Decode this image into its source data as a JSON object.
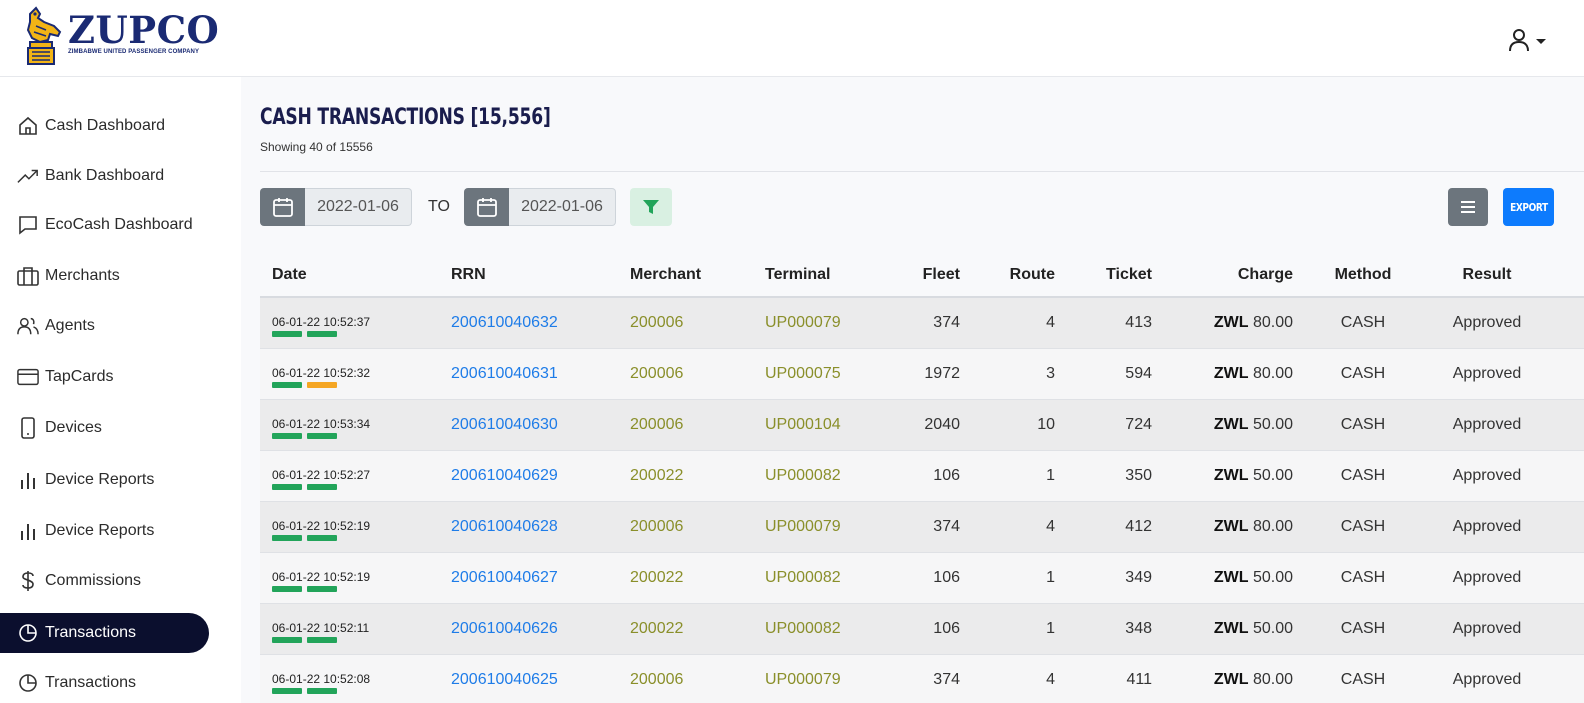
{
  "brand": {
    "name": "ZUPCO",
    "subtitle": "ZIMBABWE UNITED PASSENGER COMPANY",
    "logo_icon": "zimbabwe-bird-icon"
  },
  "header": {
    "user_icon": "user-icon"
  },
  "sidebar": {
    "items": [
      {
        "label": "Cash Dashboard",
        "icon": "home-icon"
      },
      {
        "label": "Bank Dashboard",
        "icon": "trend-up-icon"
      },
      {
        "label": "EcoCash Dashboard",
        "icon": "chat-icon"
      },
      {
        "label": "Merchants",
        "icon": "briefcase-icon"
      },
      {
        "label": "Agents",
        "icon": "people-icon"
      },
      {
        "label": "TapCards",
        "icon": "card-icon"
      },
      {
        "label": "Devices",
        "icon": "phone-icon"
      },
      {
        "label": "Device Reports",
        "icon": "bar-chart-icon"
      },
      {
        "label": "Device Reports",
        "icon": "bar-chart-icon"
      },
      {
        "label": "Commissions",
        "icon": "dollar-icon"
      },
      {
        "label": "Transactions",
        "icon": "pie-chart-icon",
        "active": true
      },
      {
        "label": "Transactions",
        "icon": "pie-chart-icon"
      }
    ]
  },
  "main": {
    "title": "CASH TRANSACTIONS [15,556]",
    "subtitle": "Showing 40 of 15556",
    "date_from": "2022-01-06",
    "to_label": "TO",
    "date_to": "2022-01-06",
    "export_label": "EXPORT"
  },
  "colors": {
    "accent": "#0d7bfd",
    "active_nav": "#0b0f2e",
    "status_green": "#22a45a",
    "status_orange": "#f5a623",
    "link": "#1e7ce8",
    "olive": "#8a8f2a"
  },
  "table": {
    "headers": [
      "Date",
      "RRN",
      "Merchant",
      "Terminal",
      "Fleet",
      "Route",
      "Ticket",
      "Charge",
      "Method",
      "Result"
    ],
    "rows": [
      {
        "date": "06-01-22 10:52:37",
        "bars": [
          "green",
          "green"
        ],
        "rrn": "200610040632",
        "merchant": "200006",
        "terminal": "UP000079",
        "fleet": "374",
        "route": "4",
        "ticket": "413",
        "currency": "ZWL",
        "amount": "80.00",
        "method": "CASH",
        "result": "Approved"
      },
      {
        "date": "06-01-22 10:52:32",
        "bars": [
          "green",
          "orange"
        ],
        "rrn": "200610040631",
        "merchant": "200006",
        "terminal": "UP000075",
        "fleet": "1972",
        "route": "3",
        "ticket": "594",
        "currency": "ZWL",
        "amount": "80.00",
        "method": "CASH",
        "result": "Approved"
      },
      {
        "date": "06-01-22 10:53:34",
        "bars": [
          "green",
          "green"
        ],
        "rrn": "200610040630",
        "merchant": "200006",
        "terminal": "UP000104",
        "fleet": "2040",
        "route": "10",
        "ticket": "724",
        "currency": "ZWL",
        "amount": "50.00",
        "method": "CASH",
        "result": "Approved"
      },
      {
        "date": "06-01-22 10:52:27",
        "bars": [
          "green",
          "green"
        ],
        "rrn": "200610040629",
        "merchant": "200022",
        "terminal": "UP000082",
        "fleet": "106",
        "route": "1",
        "ticket": "350",
        "currency": "ZWL",
        "amount": "50.00",
        "method": "CASH",
        "result": "Approved"
      },
      {
        "date": "06-01-22 10:52:19",
        "bars": [
          "green",
          "green"
        ],
        "rrn": "200610040628",
        "merchant": "200006",
        "terminal": "UP000079",
        "fleet": "374",
        "route": "4",
        "ticket": "412",
        "currency": "ZWL",
        "amount": "80.00",
        "method": "CASH",
        "result": "Approved"
      },
      {
        "date": "06-01-22 10:52:19",
        "bars": [
          "green",
          "green"
        ],
        "rrn": "200610040627",
        "merchant": "200022",
        "terminal": "UP000082",
        "fleet": "106",
        "route": "1",
        "ticket": "349",
        "currency": "ZWL",
        "amount": "50.00",
        "method": "CASH",
        "result": "Approved"
      },
      {
        "date": "06-01-22 10:52:11",
        "bars": [
          "green",
          "green"
        ],
        "rrn": "200610040626",
        "merchant": "200022",
        "terminal": "UP000082",
        "fleet": "106",
        "route": "1",
        "ticket": "348",
        "currency": "ZWL",
        "amount": "50.00",
        "method": "CASH",
        "result": "Approved"
      },
      {
        "date": "06-01-22 10:52:08",
        "bars": [
          "green",
          "green"
        ],
        "rrn": "200610040625",
        "merchant": "200006",
        "terminal": "UP000079",
        "fleet": "374",
        "route": "4",
        "ticket": "411",
        "currency": "ZWL",
        "amount": "80.00",
        "method": "CASH",
        "result": "Approved"
      }
    ]
  }
}
